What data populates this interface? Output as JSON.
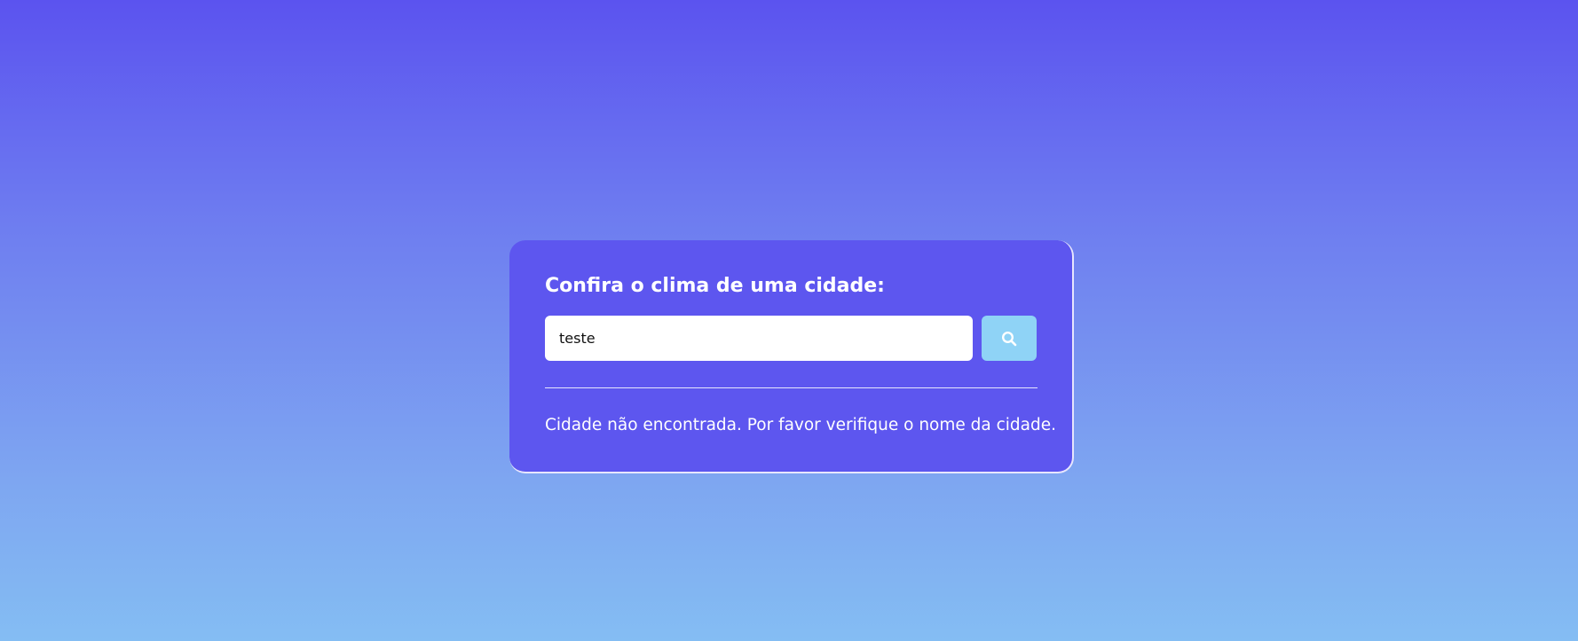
{
  "weather_card": {
    "title": "Confira o clima de uma cidade:",
    "search": {
      "value": "teste",
      "icon": "search-icon"
    },
    "message": "Cidade não encontrada. Por favor verifique o nome da cidade."
  },
  "colors": {
    "background_top": "#5b53ef",
    "background_bottom": "#84bdf3",
    "card": "#5d56ef",
    "search_button": "#8fd3f6"
  }
}
